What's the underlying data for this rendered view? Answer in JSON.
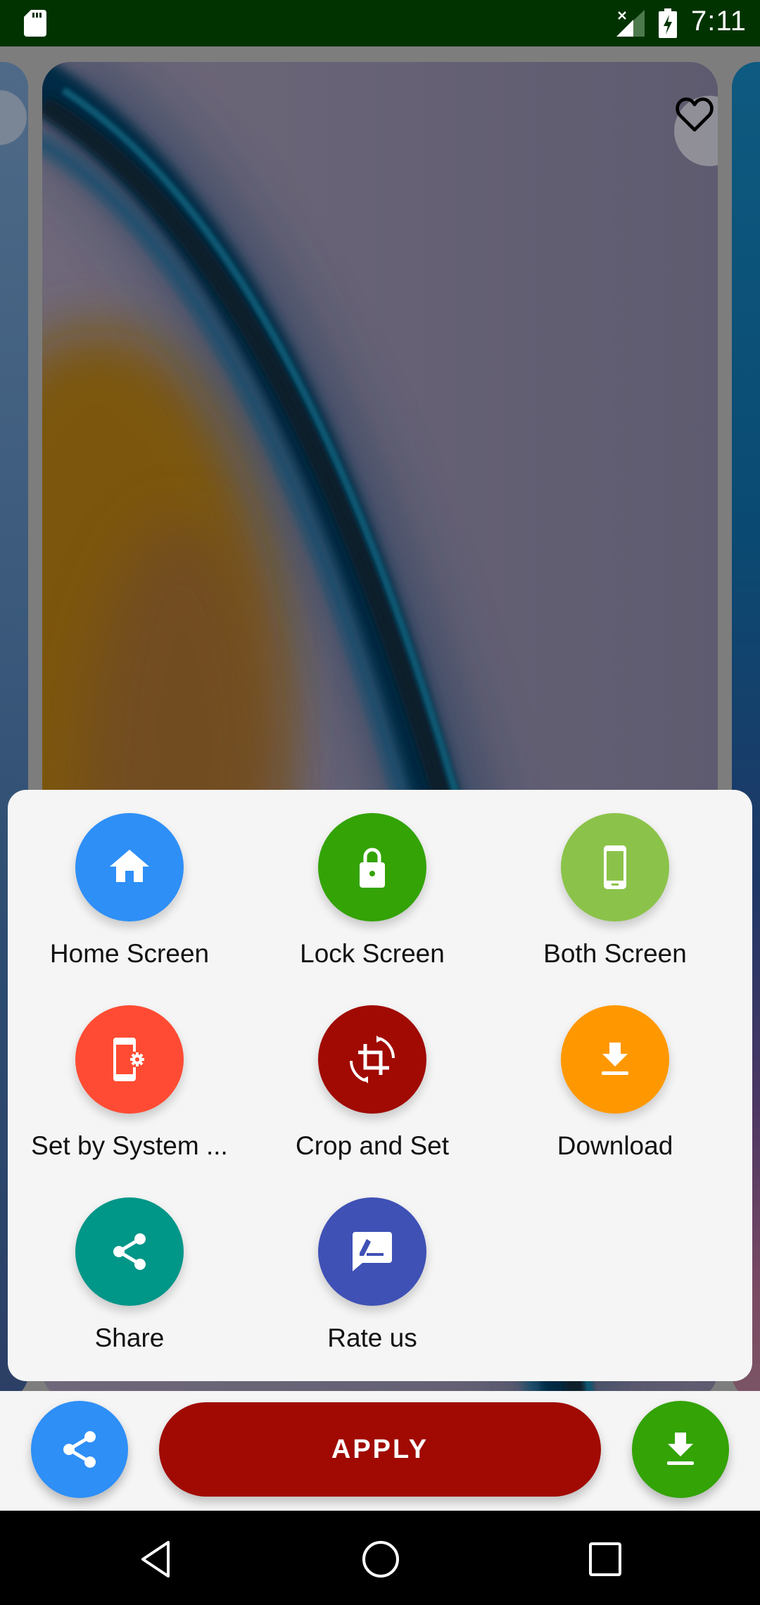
{
  "status_bar": {
    "time": "7:11",
    "icons": [
      "sd-card-icon",
      "signal-no-service-icon",
      "battery-charging-icon"
    ]
  },
  "wallpaper": {
    "favorite_icon": "heart-outline-icon",
    "favorited": false
  },
  "sheet": {
    "items": [
      {
        "label": "Home Screen",
        "icon": "home-icon",
        "color": "#2e8ff7"
      },
      {
        "label": "Lock Screen",
        "icon": "lock-icon",
        "color": "#33a306"
      },
      {
        "label": "Both Screen",
        "icon": "smartphone-icon",
        "color": "#8bc34a"
      },
      {
        "label": "Set by System ...",
        "icon": "phone-settings-icon",
        "color": "#ff4b33"
      },
      {
        "label": "Crop and Set",
        "icon": "crop-rotate-icon",
        "color": "#a00a03"
      },
      {
        "label": "Download",
        "icon": "download-icon",
        "color": "#ff9800"
      },
      {
        "label": "Share",
        "icon": "share-icon",
        "color": "#009688"
      },
      {
        "label": "Rate us",
        "icon": "rate-review-icon",
        "color": "#3f51b5"
      }
    ]
  },
  "action_bar": {
    "share_icon": "share-icon",
    "apply_label": "APPLY",
    "download_icon": "download-icon",
    "colors": {
      "share": "#2e8ff7",
      "apply": "#a00a03",
      "download": "#33a306"
    }
  },
  "nav_bar": {
    "buttons": [
      "back-icon",
      "home-circle-icon",
      "recents-icon"
    ]
  }
}
